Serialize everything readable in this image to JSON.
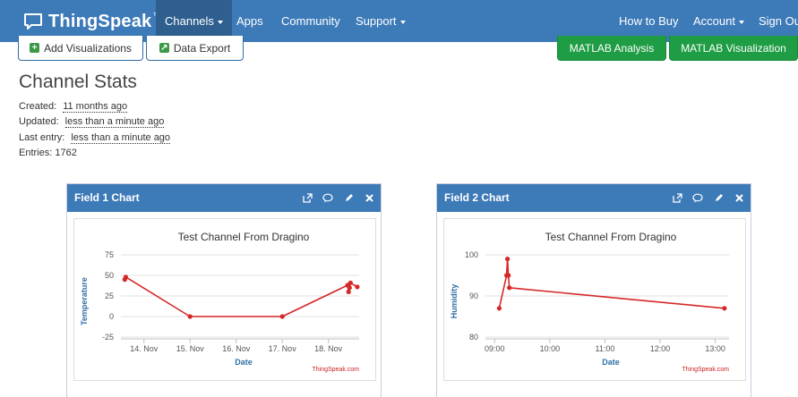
{
  "navbar": {
    "brand": "ThingSpeak",
    "brand_tm": "™",
    "items": [
      {
        "label": "Channels",
        "dropdown": true,
        "active": true
      },
      {
        "label": "Apps",
        "dropdown": false
      },
      {
        "label": "Community",
        "dropdown": false
      },
      {
        "label": "Support",
        "dropdown": true
      }
    ],
    "right_items": [
      {
        "label": "How to Buy",
        "dropdown": false
      },
      {
        "label": "Account",
        "dropdown": true
      },
      {
        "label": "Sign Out",
        "dropdown": false
      }
    ]
  },
  "actions": {
    "add_visualizations": "Add Visualizations",
    "data_export": "Data Export",
    "matlab_analysis": "MATLAB Analysis",
    "matlab_visualization": "MATLAB Visualization"
  },
  "stats": {
    "title": "Channel Stats",
    "created_label": "Created:",
    "created_value": "11 months ago",
    "updated_label": "Updated:",
    "updated_value": "less than a minute ago",
    "last_entry_label": "Last entry:",
    "last_entry_value": "less than a minute ago",
    "entries_label": "Entries:",
    "entries_value": "1762"
  },
  "colors": {
    "navbar": "#3d7ab8",
    "navbar_active": "#2e5f8f",
    "green_button": "#1f9d45",
    "series_line": "#d62728",
    "axis_label": "#2f6ea8"
  },
  "panels": [
    {
      "title": "Field 1 Chart",
      "tools": [
        "external-link-icon",
        "comment-icon",
        "pencil-icon",
        "close-icon"
      ]
    },
    {
      "title": "Field 2 Chart",
      "tools": [
        "external-link-icon",
        "comment-icon",
        "pencil-icon",
        "close-icon"
      ]
    }
  ],
  "chart_data": [
    {
      "type": "line",
      "title": "Test Channel From Dragino",
      "xlabel": "Date",
      "ylabel": "Temperature",
      "credit": "ThingSpeak.com",
      "ylim": [
        -25,
        75
      ],
      "yticks": [
        "75",
        "50",
        "25",
        "0",
        "-25"
      ],
      "ytick_values": [
        75,
        50,
        25,
        0,
        -25
      ],
      "xlim": [
        "2016-11-13 12:00",
        "2016-11-18 16:00"
      ],
      "xticks": [
        "14. Nov",
        "15. Nov",
        "16. Nov",
        "17. Nov",
        "18. Nov"
      ],
      "xtick_values": [
        "2016-11-14",
        "2016-11-15",
        "2016-11-16",
        "2016-11-17",
        "2016-11-18"
      ],
      "x": [
        "2016-11-13 14:00",
        "2016-11-13 14:30",
        "2016-11-15 00:00",
        "2016-11-17 00:00",
        "2016-11-18 10:00",
        "2016-11-18 10:30",
        "2016-11-18 11:00",
        "2016-11-18 11:30",
        "2016-11-18 15:00"
      ],
      "y": [
        45,
        48,
        0,
        0,
        38,
        30,
        35,
        41,
        36
      ],
      "grid": true
    },
    {
      "type": "line",
      "title": "Test Channel From Dragino",
      "xlabel": "Date",
      "ylabel": "Humidity",
      "credit": "ThingSpeak.com",
      "ylim": [
        80,
        100
      ],
      "yticks": [
        "100",
        "90",
        "80"
      ],
      "ytick_values": [
        100,
        90,
        80
      ],
      "xlim": [
        "08:50",
        "13:15"
      ],
      "xticks": [
        "09:00",
        "10:00",
        "11:00",
        "12:00",
        "13:00"
      ],
      "xtick_values": [
        "09:00",
        "10:00",
        "11:00",
        "12:00",
        "13:00"
      ],
      "x": [
        "09:05",
        "09:13",
        "09:14",
        "09:15",
        "09:16",
        "13:10"
      ],
      "y": [
        87,
        95,
        99,
        95,
        92,
        87
      ],
      "grid": true
    }
  ]
}
